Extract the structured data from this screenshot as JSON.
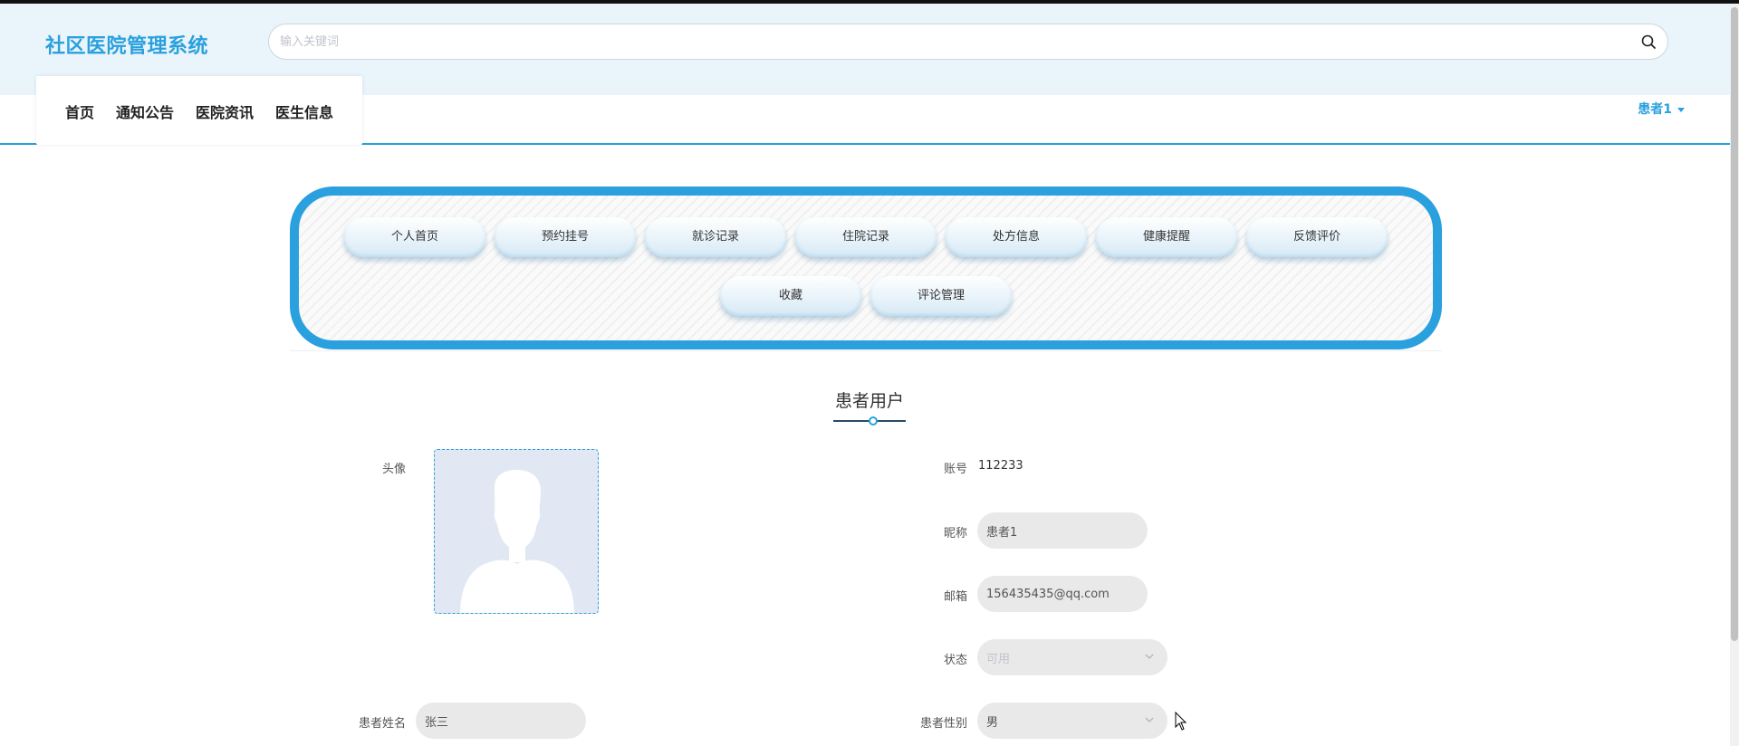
{
  "header": {
    "site_title": "社区医院管理系统",
    "search_placeholder": "输入关键词"
  },
  "nav": {
    "items": [
      {
        "label": "首页"
      },
      {
        "label": "通知公告"
      },
      {
        "label": "医院资讯"
      },
      {
        "label": "医生信息"
      }
    ],
    "user_label": "患者1"
  },
  "center_menu": {
    "items": [
      {
        "label": "个人首页"
      },
      {
        "label": "预约挂号"
      },
      {
        "label": "就诊记录"
      },
      {
        "label": "住院记录"
      },
      {
        "label": "处方信息"
      },
      {
        "label": "健康提醒"
      },
      {
        "label": "反馈评价"
      },
      {
        "label": "收藏"
      },
      {
        "label": "评论管理"
      }
    ]
  },
  "profile": {
    "section_title": "患者用户",
    "avatar_label": "头像",
    "account_label": "账号",
    "account_value": "112233",
    "nickname_label": "昵称",
    "nickname_value": "患者1",
    "email_label": "邮箱",
    "email_value": "156435435@qq.com",
    "status_label": "状态",
    "status_value": "可用",
    "name_label": "患者姓名",
    "name_value": "张三",
    "gender_label": "患者性别",
    "gender_value": "男"
  },
  "colors": {
    "accent": "#2aa0de",
    "header_bg": "#eaf4fb",
    "field_bg": "#e9e9e9"
  }
}
